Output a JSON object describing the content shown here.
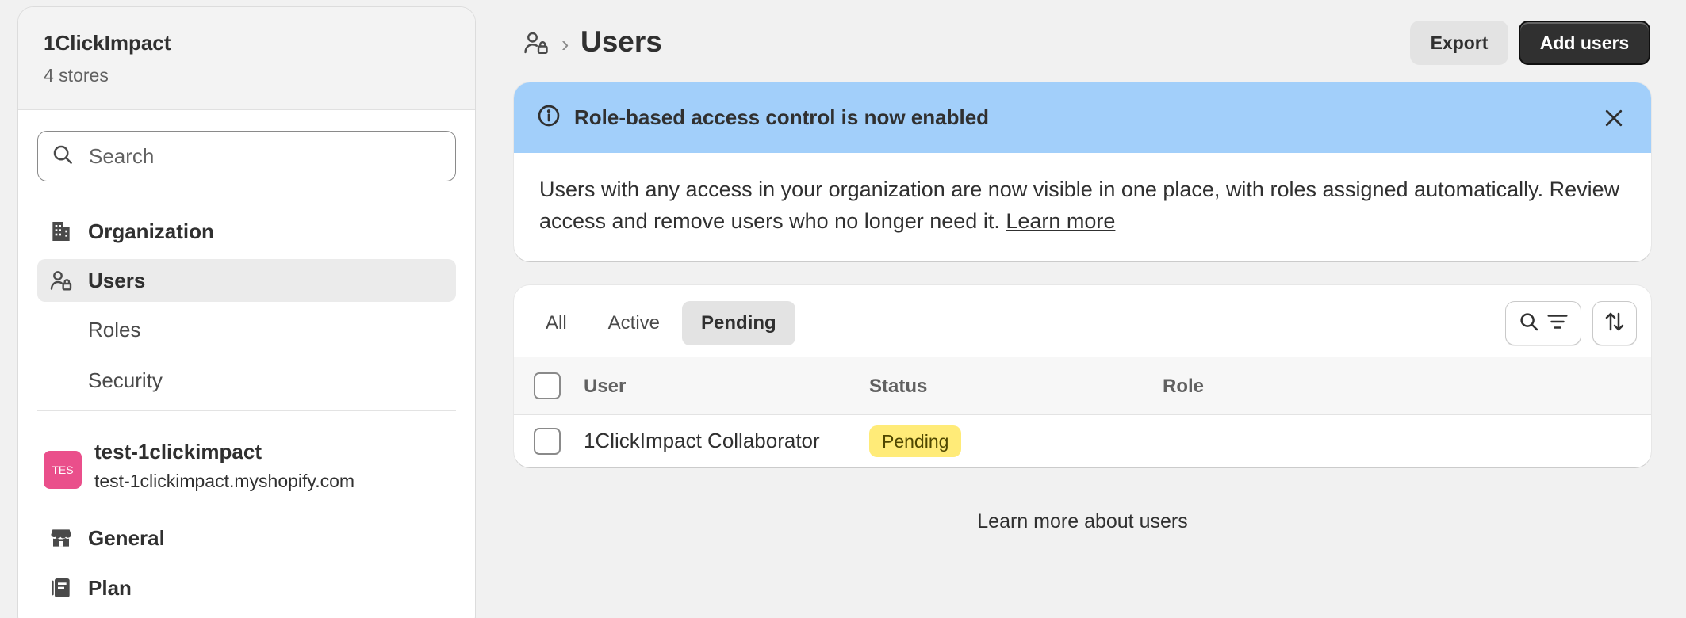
{
  "sidebar": {
    "org_name": "1ClickImpact",
    "org_sub": "4 stores",
    "search_placeholder": "Search",
    "nav": {
      "organization": "Organization",
      "users": "Users",
      "roles": "Roles",
      "security": "Security"
    },
    "store": {
      "avatar": "TES",
      "name": "test-1clickimpact",
      "domain": "test-1clickimpact.myshopify.com",
      "avatar_color": "#ea4f8b"
    },
    "store_nav": {
      "general": "General",
      "plan": "Plan"
    }
  },
  "header": {
    "title": "Users",
    "export_label": "Export",
    "add_label": "Add users"
  },
  "banner": {
    "title": "Role-based access control is now enabled",
    "body": "Users with any access in your organization are now visible in one place, with roles assigned automatically. Review access and remove users who no longer need it.",
    "link": "Learn more",
    "color": "#a2cffa"
  },
  "table": {
    "tabs": [
      "All",
      "Active",
      "Pending"
    ],
    "selected_tab": "Pending",
    "columns": [
      "User",
      "Status",
      "Role"
    ],
    "rows": [
      {
        "user": "1ClickImpact Collaborator",
        "status": "Pending",
        "role": ""
      }
    ],
    "status_badge_color": "#ffeb78"
  },
  "footer": {
    "link": "Learn more about users"
  }
}
